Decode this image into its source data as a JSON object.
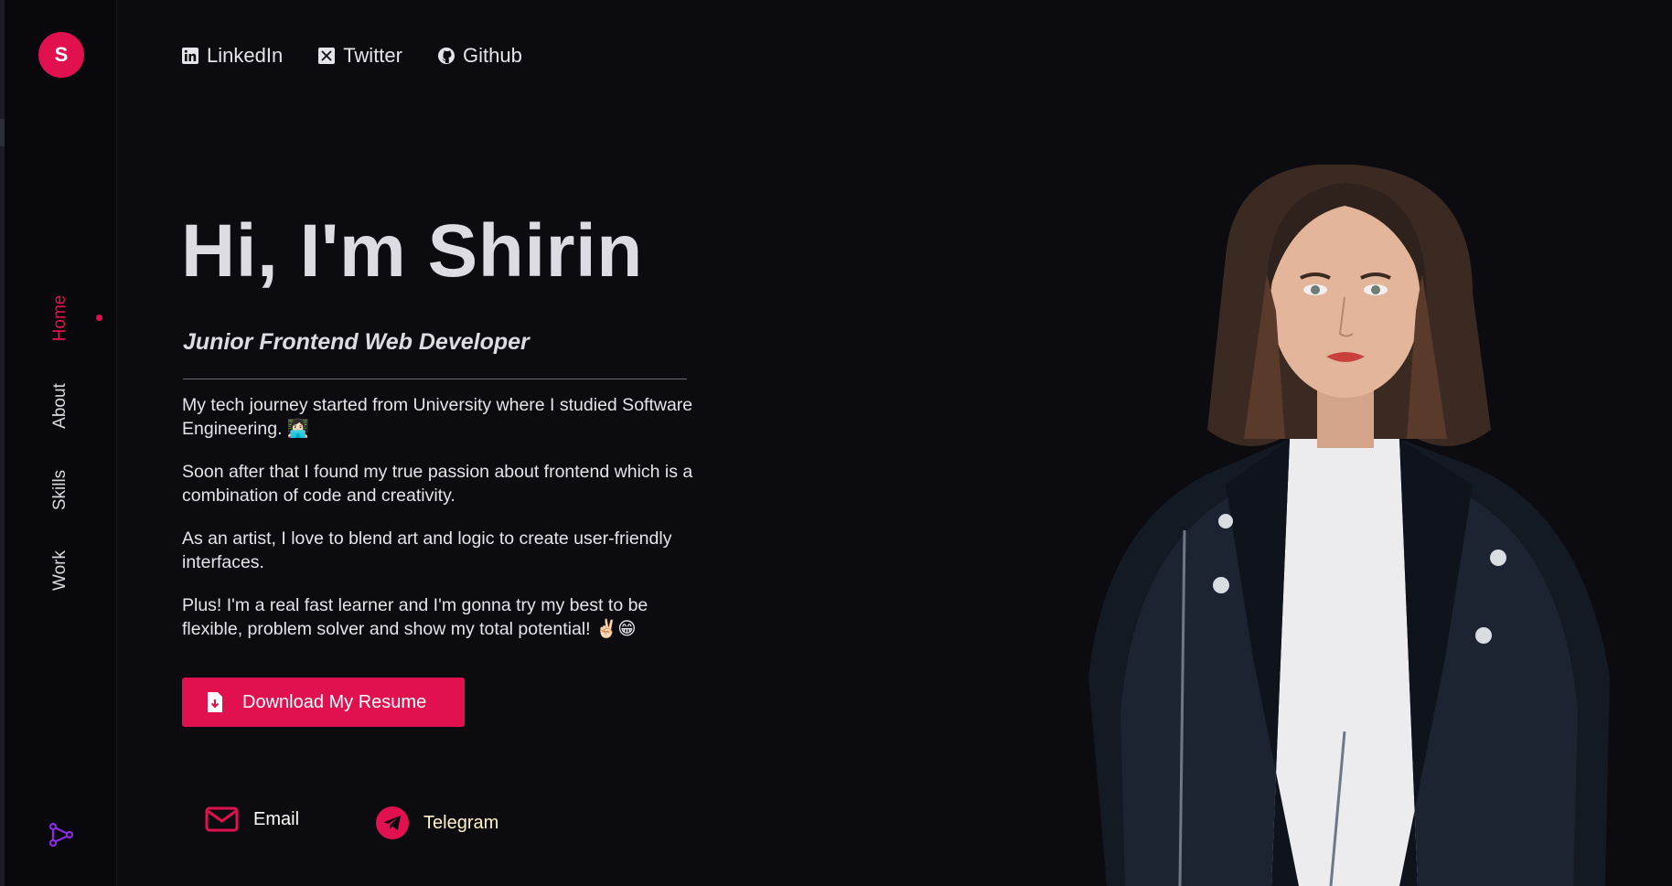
{
  "logo": {
    "letter": "S"
  },
  "sidebar": {
    "items": [
      {
        "label": "Home",
        "active": true
      },
      {
        "label": "About",
        "active": false
      },
      {
        "label": "Skills",
        "active": false
      },
      {
        "label": "Work",
        "active": false
      }
    ],
    "bottom_icon": "share-nodes-icon"
  },
  "social": [
    {
      "label": "LinkedIn",
      "icon": "linkedin-icon"
    },
    {
      "label": "Twitter",
      "icon": "x-twitter-icon"
    },
    {
      "label": "Github",
      "icon": "github-icon"
    }
  ],
  "hero": {
    "title": "Hi, I'm Shirin",
    "subtitle": "Junior Frontend Web Developer",
    "bio": [
      "My tech journey started from University where I studied Software Engineering. 👩🏻‍💻",
      "Soon after that I found my true passion about frontend which is a combination of code and creativity.",
      "As an artist, I love to blend art and logic to create user-friendly interfaces.",
      "Plus! I'm a real fast learner and I'm gonna try my best to be flexible, problem solver and show my total potential! ✌🏻😁"
    ],
    "resume_button": "Download My Resume"
  },
  "contacts": [
    {
      "label": "Email",
      "icon": "envelope-icon"
    },
    {
      "label": "Telegram",
      "icon": "telegram-icon"
    }
  ],
  "colors": {
    "accent": "#e0114e",
    "background": "#0b0b10",
    "sidebar": "#09090d",
    "text": "#e4e4ea"
  }
}
